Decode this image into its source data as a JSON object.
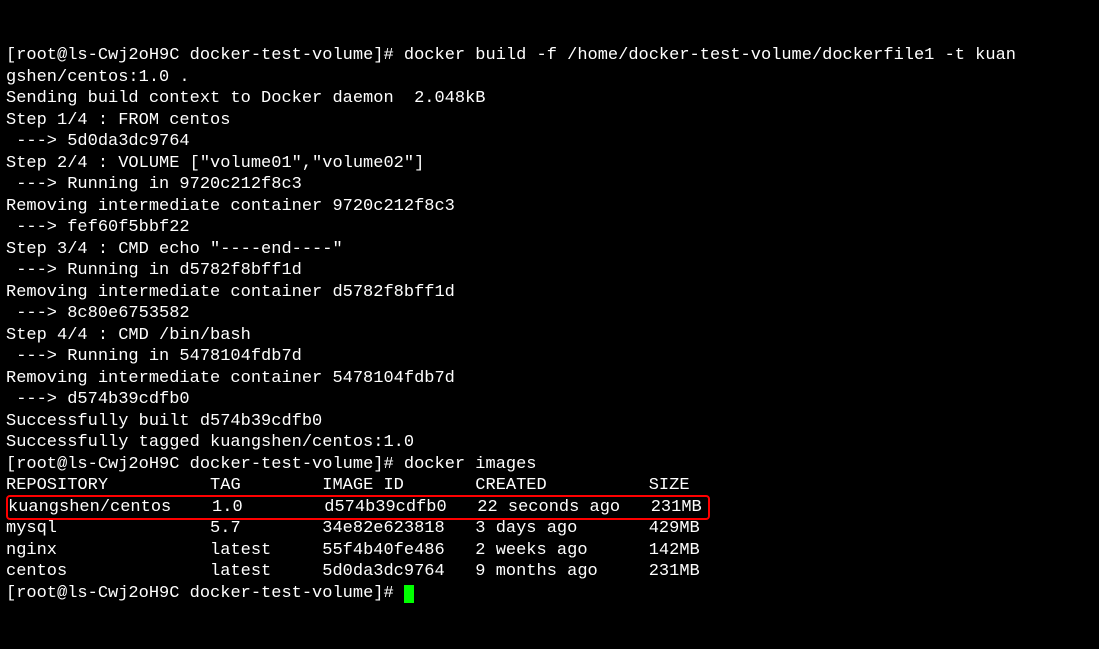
{
  "prompt1": {
    "user": "root@ls-Cwj2oH9C",
    "cwd": "docker-test-volume",
    "cmd_line1": "docker build -f /home/docker-test-volume/dockerfile1 -t kuan",
    "cmd_line2": "gshen/centos:1.0 ."
  },
  "build": {
    "l1": "Sending build context to Docker daemon  2.048kB",
    "l2": "Step 1/4 : FROM centos",
    "l3": " ---> 5d0da3dc9764",
    "l4": "Step 2/4 : VOLUME [\"volume01\",\"volume02\"]",
    "l5": " ---> Running in 9720c212f8c3",
    "l6": "Removing intermediate container 9720c212f8c3",
    "l7": " ---> fef60f5bbf22",
    "l8": "Step 3/4 : CMD echo \"----end----\"",
    "l9": " ---> Running in d5782f8bff1d",
    "l10": "Removing intermediate container d5782f8bff1d",
    "l11": " ---> 8c80e6753582",
    "l12": "Step 4/4 : CMD /bin/bash",
    "l13": " ---> Running in 5478104fdb7d",
    "l14": "Removing intermediate container 5478104fdb7d",
    "l15": " ---> d574b39cdfb0",
    "l16": "Successfully built d574b39cdfb0",
    "l17": "Successfully tagged kuangshen/centos:1.0"
  },
  "prompt2": {
    "user": "root@ls-Cwj2oH9C",
    "cwd": "docker-test-volume",
    "cmd": "docker images"
  },
  "table": {
    "header": {
      "repo": "REPOSITORY",
      "tag": "TAG",
      "id": "IMAGE ID",
      "created": "CREATED",
      "size": "SIZE"
    },
    "rows": [
      {
        "repo": "kuangshen/centos",
        "tag": "1.0",
        "id": "d574b39cdfb0",
        "created": "22 seconds ago",
        "size": "231MB"
      },
      {
        "repo": "mysql",
        "tag": "5.7",
        "id": "34e82e623818",
        "created": "3 days ago",
        "size": "429MB"
      },
      {
        "repo": "nginx",
        "tag": "latest",
        "id": "55f4b40fe486",
        "created": "2 weeks ago",
        "size": "142MB"
      },
      {
        "repo": "centos",
        "tag": "latest",
        "id": "5d0da3dc9764",
        "created": "9 months ago",
        "size": "231MB"
      }
    ]
  },
  "prompt3": {
    "user": "root@ls-Cwj2oH9C",
    "cwd": "docker-test-volume"
  }
}
